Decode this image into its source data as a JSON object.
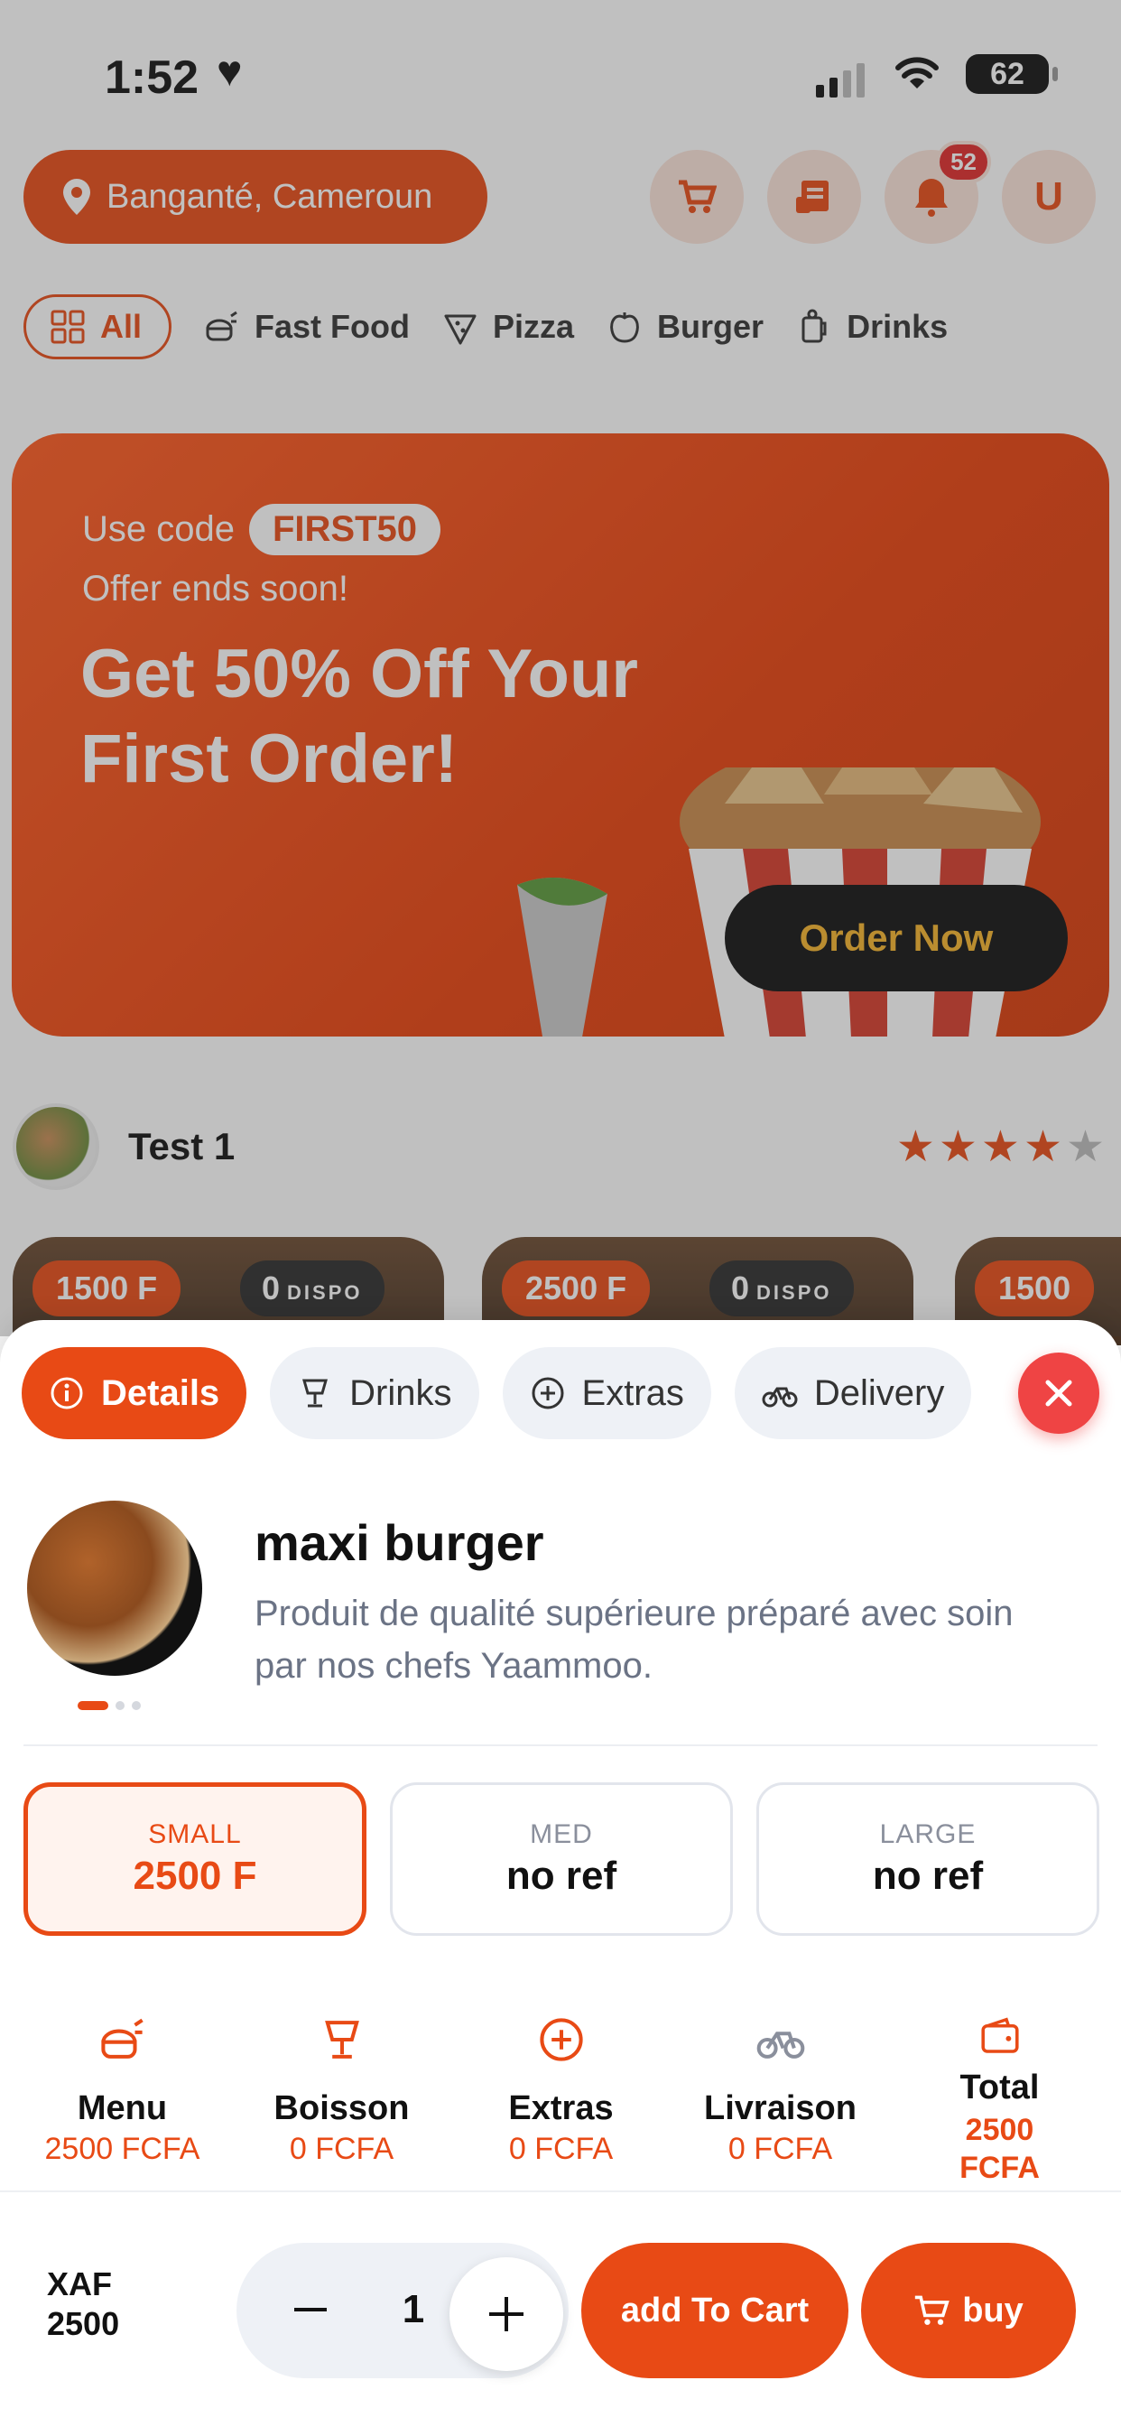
{
  "status_bar": {
    "time": "1:52",
    "battery": "62"
  },
  "header": {
    "location": "Banganté, Cameroun",
    "notifications_count": "52",
    "user_initial": "U"
  },
  "categories": [
    {
      "label": "All",
      "icon": "grid-icon"
    },
    {
      "label": "Fast Food",
      "icon": "fast-food-icon"
    },
    {
      "label": "Pizza",
      "icon": "pizza-icon"
    },
    {
      "label": "Burger",
      "icon": "burger-icon"
    },
    {
      "label": "Drinks",
      "icon": "drinks-icon"
    }
  ],
  "banner": {
    "code_prefix": "Use code",
    "code": "FIRST50",
    "subtitle": "Offer ends soon!",
    "headline": "Get 50% Off Your First Order!",
    "cta": "Order Now"
  },
  "restaurant": {
    "name": "Test 1",
    "rating": 4.5
  },
  "product_cards": [
    {
      "price": "1500 F",
      "dispo_count": "0",
      "dispo_label": "DISPO"
    },
    {
      "price": "2500 F",
      "dispo_count": "0",
      "dispo_label": "DISPO"
    },
    {
      "price": "1500"
    }
  ],
  "sheet": {
    "tabs": [
      {
        "label": "Details",
        "icon": "info-icon"
      },
      {
        "label": "Drinks",
        "icon": "cocktail-icon"
      },
      {
        "label": "Extras",
        "icon": "plus-circle-icon"
      },
      {
        "label": "Delivery",
        "icon": "bike-icon"
      }
    ],
    "product": {
      "name": "maxi burger",
      "description": "Produit de qualité supérieure préparé avec soin par nos chefs Yaammoo."
    },
    "sizes": [
      {
        "label": "SMALL",
        "value": "2500 F"
      },
      {
        "label": "MED",
        "value": "no ref"
      },
      {
        "label": "LARGE",
        "value": "no ref"
      }
    ],
    "summary": [
      {
        "title": "Menu",
        "value": "2500 FCFA",
        "icon": "fast-food-icon"
      },
      {
        "title": "Boisson",
        "value": "0 FCFA",
        "icon": "cocktail-icon"
      },
      {
        "title": "Extras",
        "value": "0 FCFA",
        "icon": "plus-circle-icon"
      },
      {
        "title": "Livraison",
        "value": "0 FCFA",
        "icon": "bike-icon"
      },
      {
        "title": "Total",
        "value": "2500 FCFA",
        "icon": "wallet-icon"
      }
    ],
    "footer": {
      "currency": "XAF",
      "amount": "2500",
      "quantity": "1",
      "add_to_cart": "add To Cart",
      "buy": "buy"
    }
  },
  "colors": {
    "accent": "#e84a15",
    "close": "#ef4444",
    "dark": "#111111"
  }
}
